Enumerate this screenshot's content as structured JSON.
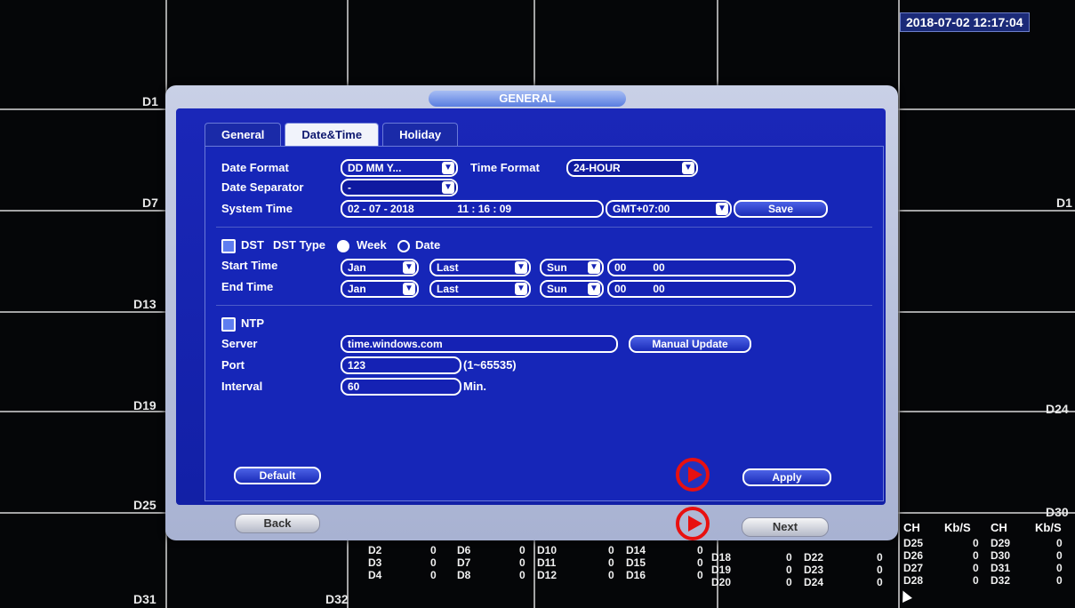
{
  "clock": "2018-07-02 12:17:04",
  "channel_labels": [
    "D1",
    "D7",
    "D13",
    "D19",
    "D25",
    "D31",
    "D32",
    "D30",
    "D24",
    "D1"
  ],
  "dialog": {
    "title": "GENERAL",
    "tabs": [
      "General",
      "Date&Time",
      "Holiday"
    ],
    "active_tab": "Date&Time",
    "date_format_label": "Date Format",
    "date_format_value": "DD MM Y...",
    "time_format_label": "Time Format",
    "time_format_value": "24-HOUR",
    "date_separator_label": "Date Separator",
    "date_separator_value": "-",
    "system_time_label": "System Time",
    "system_date_value": "02 - 07 - 2018",
    "system_clock_value": "11 : 16 : 09",
    "timezone_value": "GMT+07:00",
    "save_label": "Save",
    "dst_label": "DST",
    "dst_type_label": "DST Type",
    "week_label": "Week",
    "date_label": "Date",
    "start_time_label": "Start Time",
    "end_time_label": "End Time",
    "start": {
      "month": "Jan",
      "week": "Last",
      "day": "Sun",
      "hour": "00",
      "min": "00"
    },
    "end": {
      "month": "Jan",
      "week": "Last",
      "day": "Sun",
      "hour": "00",
      "min": "00"
    },
    "ntp_label": "NTP",
    "server_label": "Server",
    "server_value": "time.windows.com",
    "manual_update_label": "Manual Update",
    "port_label": "Port",
    "port_value": "123",
    "port_range": "(1~65535)",
    "interval_label": "Interval",
    "interval_value": "60",
    "interval_unit": "Min.",
    "default_label": "Default",
    "apply_label": "Apply",
    "back_label": "Back",
    "next_label": "Next"
  },
  "stats": {
    "header": [
      "CH",
      "Kb/S",
      "CH",
      "Kb/S"
    ],
    "col1": [
      [
        "D2",
        "0",
        "D6",
        "0"
      ],
      [
        "D3",
        "0",
        "D7",
        "0"
      ],
      [
        "D4",
        "0",
        "D8",
        "0"
      ]
    ],
    "col2": [
      [
        "D10",
        "0",
        "D14",
        "0"
      ],
      [
        "D11",
        "0",
        "D15",
        "0"
      ],
      [
        "D12",
        "0",
        "D16",
        "0"
      ]
    ],
    "col3": [
      [
        "D18",
        "0",
        "D22",
        "0"
      ],
      [
        "D19",
        "0",
        "D23",
        "0"
      ],
      [
        "D20",
        "0",
        "D24",
        "0"
      ]
    ],
    "col4": [
      [
        "D25",
        "0",
        "D29",
        "0"
      ],
      [
        "D26",
        "0",
        "D30",
        "0"
      ],
      [
        "D27",
        "0",
        "D31",
        "0"
      ],
      [
        "D28",
        "0",
        "D32",
        "0"
      ]
    ]
  }
}
